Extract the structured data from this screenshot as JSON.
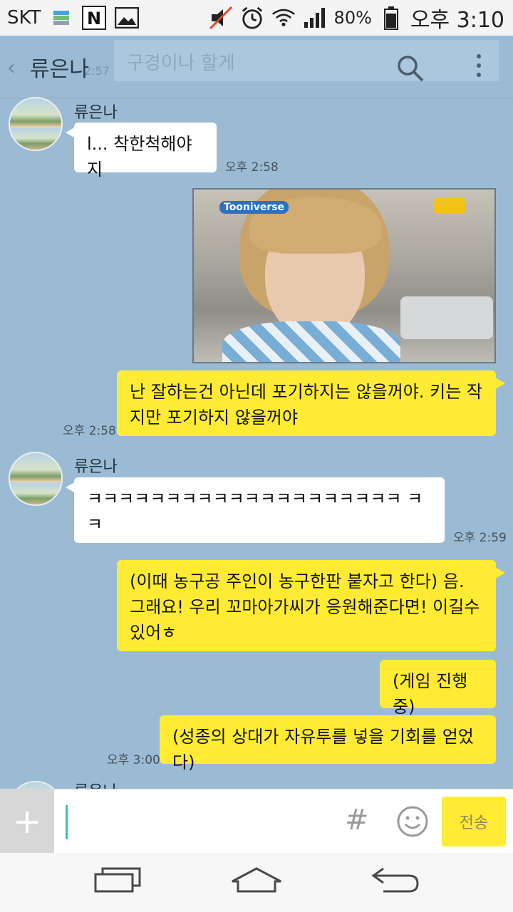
{
  "status_bar": {
    "carrier": "SKT",
    "battery": "80%",
    "time": "오후 3:10",
    "icons": [
      "sim-icon",
      "naver-icon",
      "image-icon",
      "mute-icon",
      "alarm-icon",
      "wifi-icon",
      "signal-icon",
      "battery-icon"
    ]
  },
  "header": {
    "title": "류은나",
    "ghost_preview": "구경이나 할게",
    "ghost_time": "2:57"
  },
  "messages": [
    {
      "sender": "류은나",
      "text": "l... 착한척해야지",
      "time": "오후 2:58"
    },
    {
      "photo_logo": "Tooniverse"
    },
    {
      "text": "난 잘하는건 아닌데 포기하지는 않을꺼야. 키는 작지만 포기하지 않을꺼야",
      "time": "오후 2:58"
    },
    {
      "sender": "류은나",
      "text": "ㅋㅋㅋㅋㅋㅋㅋㅋㅋㅋㅋㅋㅋㅋㅋㅋㅋㅋㅋㅋ ㅋㅋ",
      "time": "오후 2:59"
    },
    {
      "text": "(이때 농구공 주인이 농구한판 붙자고 한다) 음. 그래요! 우리 꼬마아가씨가 응원해준다면! 이길수있어ㅎ"
    },
    {
      "text": "(게임 진행중)"
    },
    {
      "text": "(성종의 상대가 자유투를 넣을 기회를 얻었다)",
      "time": "오후 3:00"
    },
    {
      "sender": "류은나"
    }
  ],
  "input": {
    "plus": "+",
    "hash": "#",
    "send_label": "전송"
  },
  "colors": {
    "chat_bg": "#9bbbd4",
    "my_bubble": "#ffeb33",
    "their_bubble": "#ffffff"
  }
}
